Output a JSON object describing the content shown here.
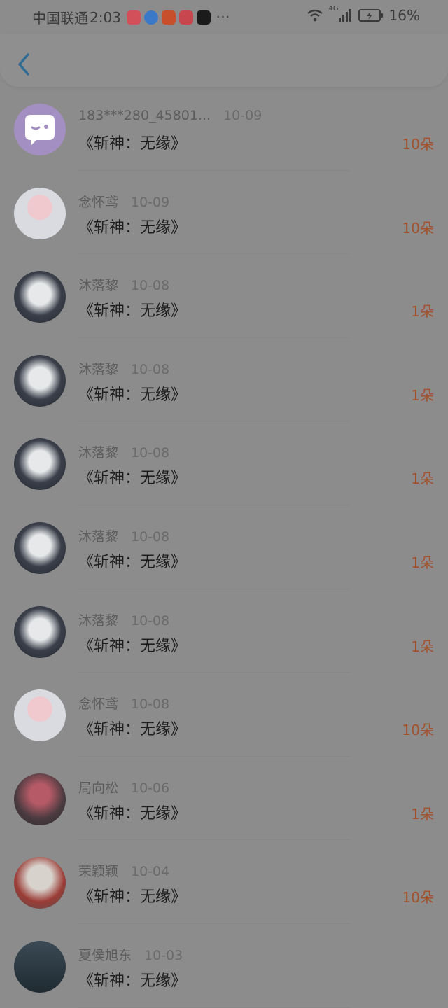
{
  "status_bar": {
    "carrier": "中国联通",
    "time": "2:03",
    "network": "4G",
    "battery": "16%",
    "more": "···",
    "app_colors": [
      "#d2505a",
      "#3c78c8",
      "#c84f2c",
      "#c8464e",
      "#1b1b1b"
    ]
  },
  "header": {
    "back_icon": "chevron-left-icon",
    "accent": "#2f6b93"
  },
  "colors": {
    "amount": "#a3502a",
    "background": "#8c8c8c"
  },
  "records": [
    {
      "name": "183***280_45801...",
      "date": "10-09",
      "title": "《斩神：无缘》",
      "amount": "10朵",
      "avatar": "chat-bubble"
    },
    {
      "name": "念怀鸢",
      "date": "10-09",
      "title": "《斩神：无缘》",
      "amount": "10朵",
      "avatar": "pink-hair"
    },
    {
      "name": "沐落黎",
      "date": "10-08",
      "title": "《斩神：无缘》",
      "amount": "1朵",
      "avatar": "white-hair"
    },
    {
      "name": "沐落黎",
      "date": "10-08",
      "title": "《斩神：无缘》",
      "amount": "1朵",
      "avatar": "white-hair"
    },
    {
      "name": "沐落黎",
      "date": "10-08",
      "title": "《斩神：无缘》",
      "amount": "1朵",
      "avatar": "white-hair"
    },
    {
      "name": "沐落黎",
      "date": "10-08",
      "title": "《斩神：无缘》",
      "amount": "1朵",
      "avatar": "white-hair"
    },
    {
      "name": "沐落黎",
      "date": "10-08",
      "title": "《斩神：无缘》",
      "amount": "1朵",
      "avatar": "white-hair"
    },
    {
      "name": "念怀鸢",
      "date": "10-08",
      "title": "《斩神：无缘》",
      "amount": "10朵",
      "avatar": "pink-hair"
    },
    {
      "name": "局向松",
      "date": "10-06",
      "title": "《斩神：无缘》",
      "amount": "1朵",
      "avatar": "red-hair"
    },
    {
      "name": "荣颖颖",
      "date": "10-04",
      "title": "《斩神：无缘》",
      "amount": "10朵",
      "avatar": "photo-boy"
    },
    {
      "name": "夏侯旭东",
      "date": "10-03",
      "title": "《斩神：无缘》",
      "amount": "",
      "avatar": "dark-figure"
    }
  ]
}
